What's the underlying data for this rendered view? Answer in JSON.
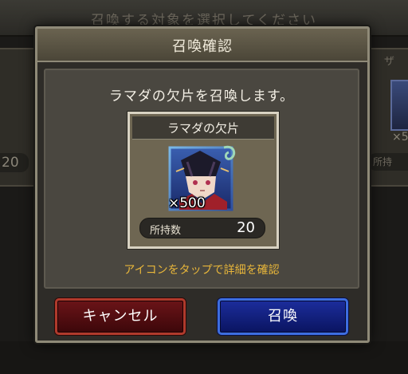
{
  "background": {
    "header_text": "召喚する対象を選択してください",
    "left_count": "20",
    "right_name": "ザ",
    "right_mult": "×5",
    "right_owned": "所持"
  },
  "dialog": {
    "title": "召喚確認",
    "message": "ラマダの欠片を召喚します。",
    "item": {
      "name": "ラマダの欠片",
      "multiplier": "×500",
      "owned_label": "所持数",
      "owned_value": "20",
      "icon": "character-portrait-icon"
    },
    "hint": "アイコンをタップで詳細を確認",
    "cancel_label": "キャンセル",
    "summon_label": "召喚"
  },
  "colors": {
    "hint": "#e8b63a",
    "cancel": "#6b1418",
    "summon": "#1c2d9c"
  }
}
